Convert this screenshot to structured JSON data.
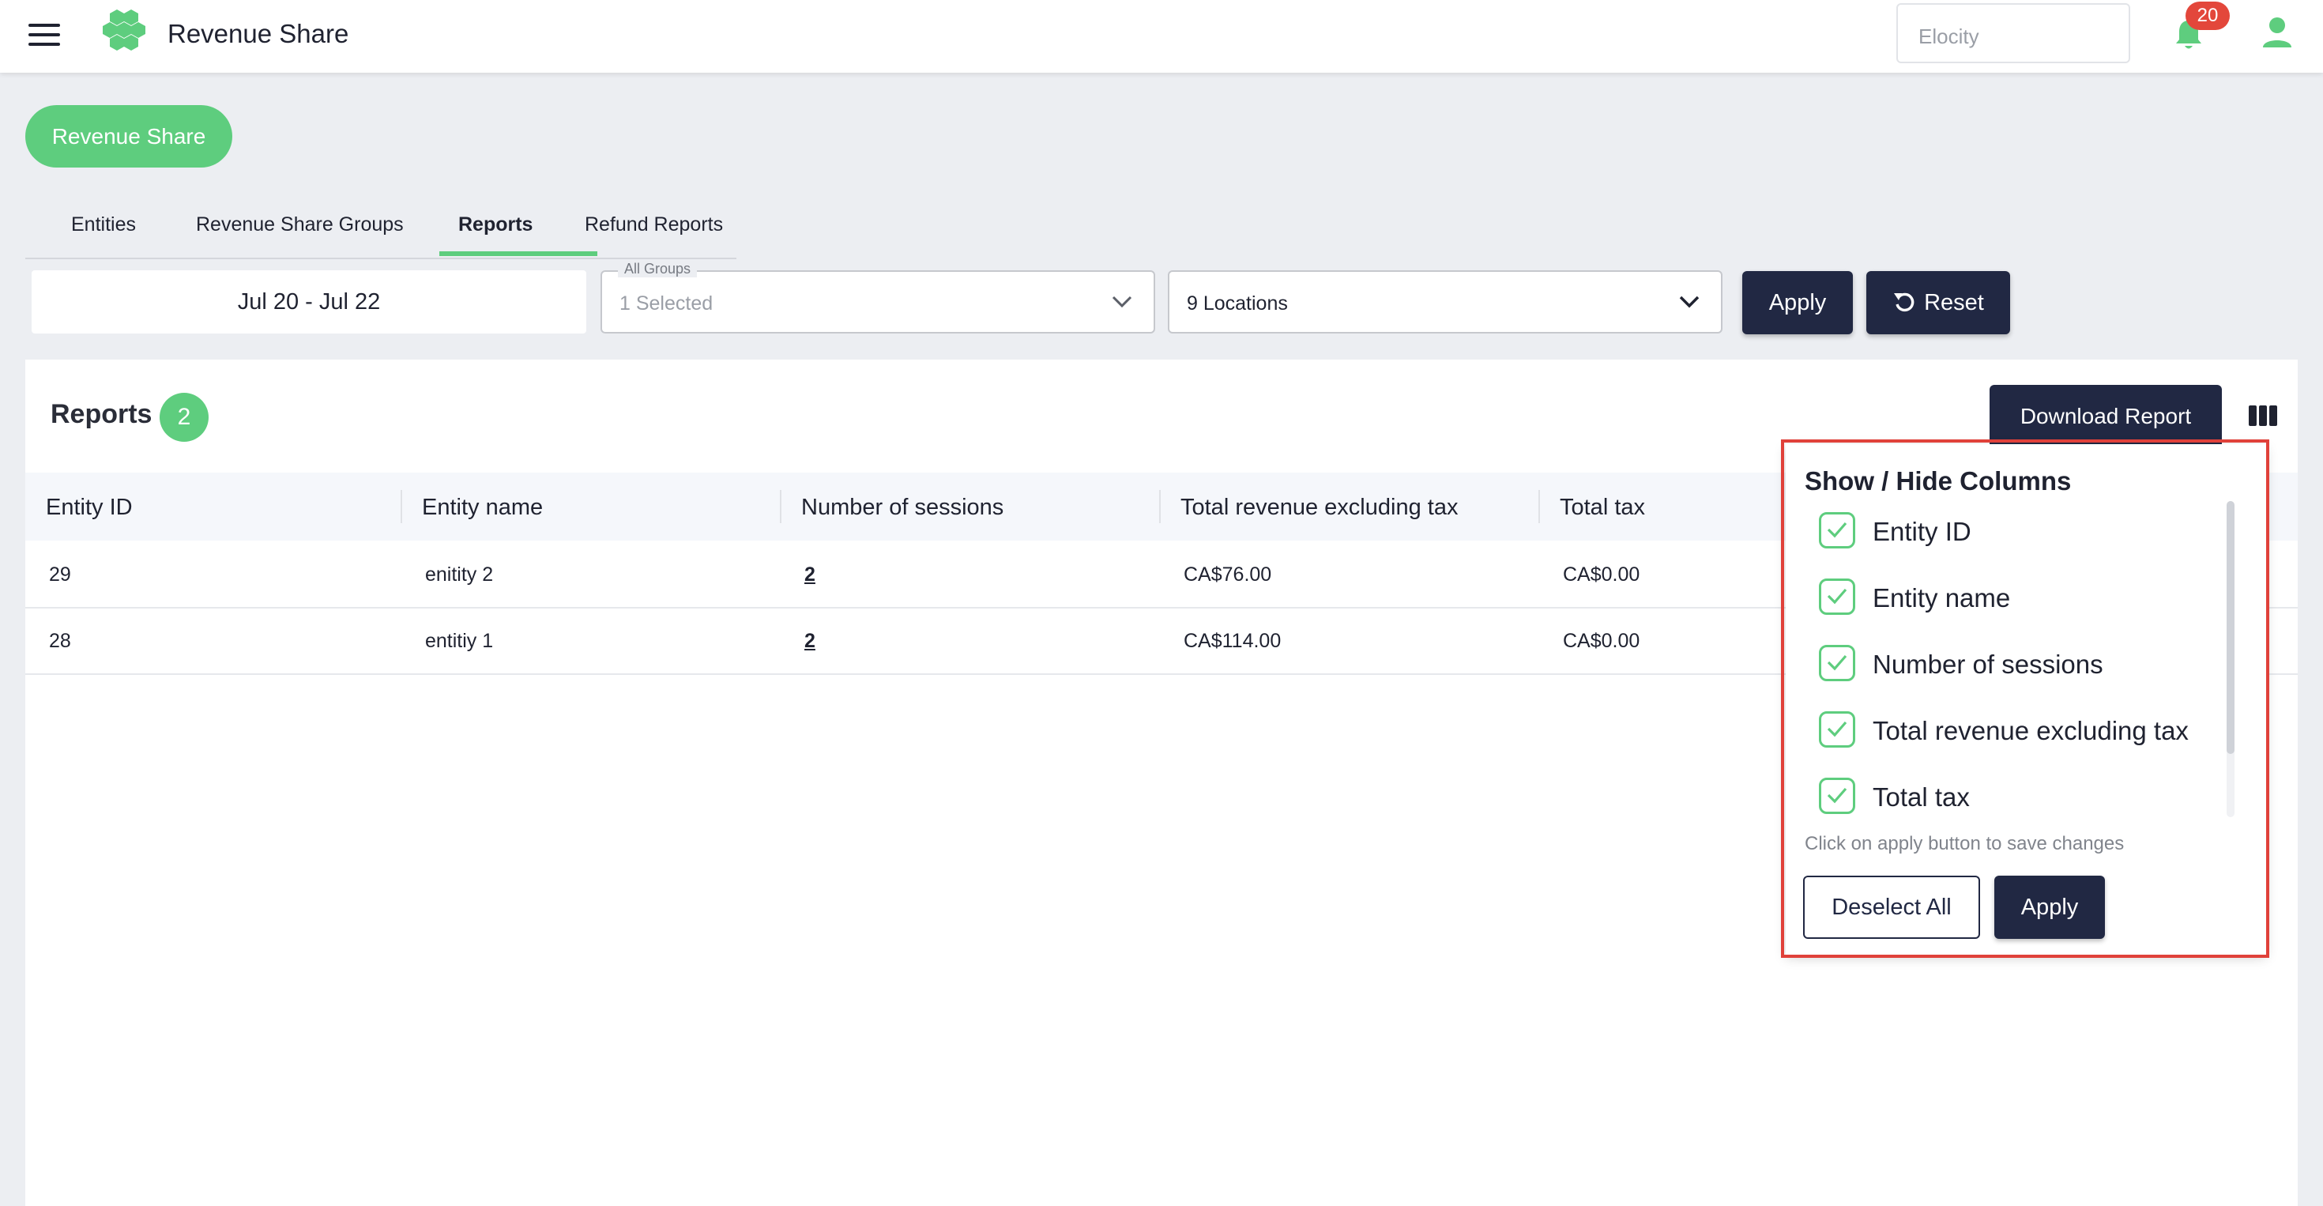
{
  "header": {
    "app_title": "Revenue Share",
    "org_select_placeholder": "Elocity",
    "notification_count": "20"
  },
  "page": {
    "title_pill": "Revenue Share",
    "tabs": [
      {
        "label": "Entities",
        "active": false
      },
      {
        "label": "Revenue Share Groups",
        "active": false
      },
      {
        "label": "Reports",
        "active": true
      },
      {
        "label": "Refund Reports",
        "active": false
      }
    ]
  },
  "filters": {
    "date_range": "Jul 20 - Jul 22",
    "groups_label": "All Groups",
    "groups_value": "1 Selected",
    "locations_value": "9 Locations",
    "apply_label": "Apply",
    "reset_label": "Reset"
  },
  "reports": {
    "title": "Reports",
    "count": "2",
    "download_label": "Download Report",
    "columns": [
      "Entity ID",
      "Entity name",
      "Number of sessions",
      "Total revenue excluding tax",
      "Total tax"
    ],
    "rows": [
      {
        "entity_id": "29",
        "entity_name": "enitity 2",
        "sessions": "2",
        "revenue": "CA$76.00",
        "tax": "CA$0.00"
      },
      {
        "entity_id": "28",
        "entity_name": "entitiy 1",
        "sessions": "2",
        "revenue": "CA$114.00",
        "tax": "CA$0.00"
      }
    ]
  },
  "column_picker": {
    "title": "Show / Hide Columns",
    "options": [
      {
        "label": "Entity ID",
        "checked": true
      },
      {
        "label": "Entity name",
        "checked": true
      },
      {
        "label": "Number of sessions",
        "checked": true
      },
      {
        "label": "Total revenue excluding tax",
        "checked": true
      },
      {
        "label": "Total tax",
        "checked": true
      }
    ],
    "hint": "Click on apply button to save changes",
    "deselect_label": "Deselect All",
    "apply_label": "Apply"
  },
  "colors": {
    "accent_green": "#5ecd7e",
    "navy": "#212843",
    "badge_red": "#e3473b",
    "highlight_red": "#e0413a"
  }
}
